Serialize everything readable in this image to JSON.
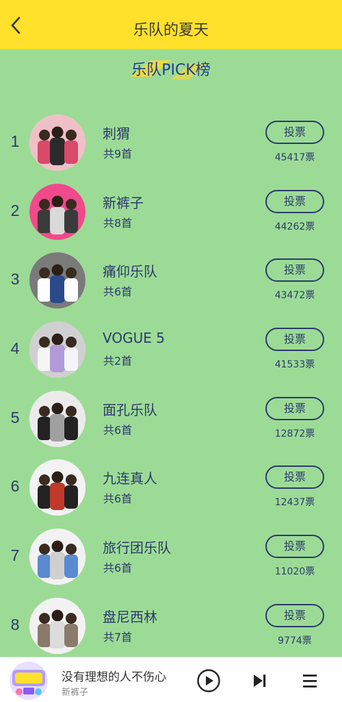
{
  "header": {
    "title": "乐队的夏天",
    "back_icon": "back-arrow-icon"
  },
  "banner": {
    "title": "乐队PICK榜"
  },
  "vote_label": "投票",
  "ranking": [
    {
      "rank": "1",
      "name": "刺猬",
      "songs": "共9首",
      "votes": "45417票"
    },
    {
      "rank": "2",
      "name": "新裤子",
      "songs": "共8首",
      "votes": "44262票"
    },
    {
      "rank": "3",
      "name": "痛仰乐队",
      "songs": "共6首",
      "votes": "43472票"
    },
    {
      "rank": "4",
      "name": "VOGUE 5",
      "songs": "共2首",
      "votes": "41533票"
    },
    {
      "rank": "5",
      "name": "面孔乐队",
      "songs": "共6首",
      "votes": "12872票"
    },
    {
      "rank": "6",
      "name": "九连真人",
      "songs": "共6首",
      "votes": "12437票"
    },
    {
      "rank": "7",
      "name": "旅行团乐队",
      "songs": "共6首",
      "votes": "11020票"
    },
    {
      "rank": "8",
      "name": "盘尼西林",
      "songs": "共7首",
      "votes": "9774票"
    }
  ],
  "player": {
    "song": "没有理想的人不伤心",
    "artist": "新裤子",
    "icons": [
      "play-icon",
      "next-track-icon",
      "playlist-menu-icon"
    ]
  },
  "colors": {
    "header": "#ffe02a",
    "background": "#9cdb96",
    "text": "#2b3a6b"
  }
}
